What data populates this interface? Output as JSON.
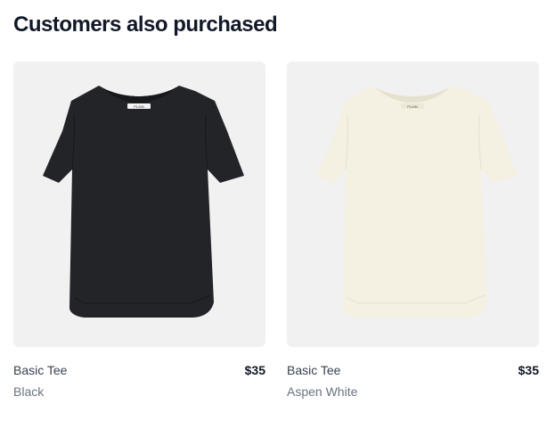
{
  "section": {
    "title": "Customers also purchased"
  },
  "products": [
    {
      "name": "Basic Tee",
      "color": "Black",
      "price": "$35",
      "image_icon": "tshirt-black-image",
      "shirt_color": "#232428",
      "shirt_shade": "#17181b",
      "tag_label": "PLAIN"
    },
    {
      "name": "Basic Tee",
      "color": "Aspen White",
      "price": "$35",
      "image_icon": "tshirt-white-image",
      "shirt_color": "#f4f0e2",
      "shirt_shade": "#e6e1cf",
      "tag_label": "PLAIN"
    }
  ],
  "colors": {
    "heading": "#111827",
    "name": "#374151",
    "subtle": "#6b7280",
    "image_background": "#f1f1f1"
  }
}
